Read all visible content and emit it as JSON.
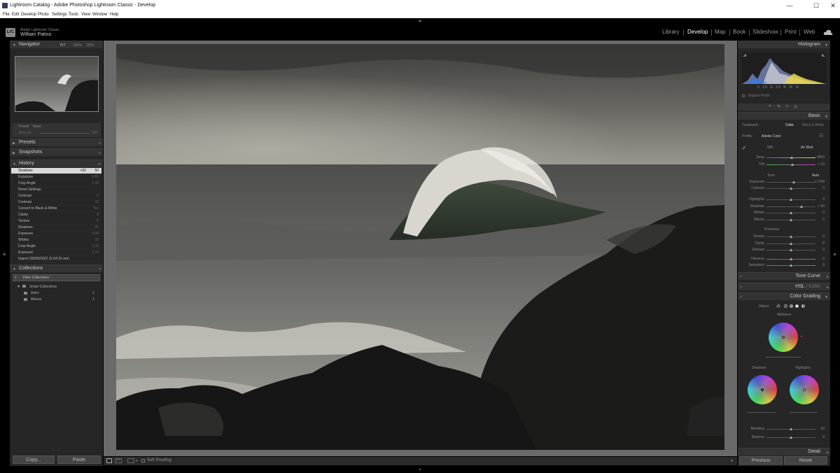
{
  "window": {
    "title": "Lightroom Catalog - Adobe Photoshop Lightroom Classic - Develop",
    "minimize": "—",
    "maximize": "☐",
    "close": "✕"
  },
  "menu": [
    "File",
    "Edit",
    "Develop",
    "Photo",
    "Settings",
    "Tools",
    "View",
    "Window",
    "Help"
  ],
  "identity": {
    "badge": "LrC",
    "app": "Adobe Lightroom Classic",
    "user": "William Patino"
  },
  "modules": [
    "Library",
    "Develop",
    "Map",
    "Book",
    "Slideshow",
    "Print",
    "Web"
  ],
  "active_module": "Develop",
  "navigator": {
    "title": "Navigator",
    "fit": "FIT",
    "z1": "100%",
    "z2": "25%"
  },
  "preset_amount": {
    "label1": "Preset",
    "label2": "None",
    "amount_label": "Amount",
    "amount_value": "100"
  },
  "left_panels": {
    "presets": "Presets",
    "snapshots": "Snapshots",
    "history": "History",
    "collections": "Collections"
  },
  "history": [
    {
      "name": "Shadows",
      "a": "+50",
      "b": "50",
      "selected": true
    },
    {
      "name": "Exposure",
      "a": "",
      "b": "0.89"
    },
    {
      "name": "Crop Angle",
      "a": "",
      "b": "1.30"
    },
    {
      "name": "Reset Settings",
      "a": "",
      "b": ""
    },
    {
      "name": "Contrast",
      "a": "",
      "b": "0"
    },
    {
      "name": "Contrast",
      "a": "",
      "b": "20"
    },
    {
      "name": "Convert to Black & White",
      "a": "",
      "b": "Yes"
    },
    {
      "name": "Clarity",
      "a": "",
      "b": "8"
    },
    {
      "name": "Texture",
      "a": "",
      "b": "5"
    },
    {
      "name": "Shadows",
      "a": "",
      "b": "31"
    },
    {
      "name": "Exposure",
      "a": "",
      "b": "0.94"
    },
    {
      "name": "Whites",
      "a": "",
      "b": "10"
    },
    {
      "name": "Crop Angle",
      "a": "",
      "b": "1.30"
    },
    {
      "name": "Exposure",
      "a": "",
      "b": "1.47"
    },
    {
      "name": "Import (30/06/2022 11:54:32 am)",
      "a": "",
      "b": ""
    }
  ],
  "collections": {
    "filter": "Filter Collections",
    "smart": "Smart Collections",
    "items": [
      {
        "name": "Astro",
        "count": "1"
      },
      {
        "name": "Waves",
        "count": "1"
      }
    ]
  },
  "left_buttons": {
    "copy": "Copy...",
    "paste": "Paste"
  },
  "toolbar": {
    "soft_proofing": "Soft Proofing"
  },
  "histogram": {
    "title": "Histogram",
    "readout": "0   1.8   G   2.0   B   16   %",
    "original": "Original Photo"
  },
  "basic": {
    "title": "Basic",
    "treatment": "Treatment :",
    "color": "Color",
    "bw": "Black & White",
    "profile_label": "Profile :",
    "profile_value": "Adobe Color",
    "wb_label": "WB :",
    "wb_value": "As Shot",
    "tone_label": "Tone",
    "auto": "Auto",
    "presence_label": "Presence",
    "sliders": [
      {
        "name": "Temp",
        "value": "4550",
        "pos": 0.52
      },
      {
        "name": "Tint",
        "value": "+ 10",
        "pos": 0.53
      },
      {
        "name": "Exposure",
        "value": "+ 0.89",
        "pos": 0.56
      },
      {
        "name": "Contrast",
        "value": "0",
        "pos": 0.5
      },
      {
        "name": "Highlights",
        "value": "0",
        "pos": 0.5
      },
      {
        "name": "Shadows",
        "value": "+ 50",
        "pos": 0.72
      },
      {
        "name": "Whites",
        "value": "0",
        "pos": 0.5
      },
      {
        "name": "Blacks",
        "value": "0",
        "pos": 0.5
      },
      {
        "name": "Texture",
        "value": "0",
        "pos": 0.5
      },
      {
        "name": "Clarity",
        "value": "0",
        "pos": 0.5
      },
      {
        "name": "Dehaze",
        "value": "0",
        "pos": 0.5
      },
      {
        "name": "Vibrance",
        "value": "0",
        "pos": 0.5
      },
      {
        "name": "Saturation",
        "value": "0",
        "pos": 0.5
      }
    ]
  },
  "tone_curve": {
    "title": "Tone Curve"
  },
  "hsl": {
    "title": "HSL",
    "sep": " / ",
    "color": "Color"
  },
  "color_grading": {
    "title": "Color Grading",
    "adjust": "Adjust :",
    "midtones": "Midtones",
    "shadows": "Shadows",
    "highlights": "Highlights",
    "blending_label": "Blending",
    "blending_value": "50",
    "blending_pos": 0.5,
    "balance_label": "Balance",
    "balance_value": "0",
    "balance_pos": 0.5
  },
  "detail": {
    "title": "Detail"
  },
  "right_buttons": {
    "previous": "Previous",
    "reset": "Reset"
  },
  "colors": {
    "bg": "#262626",
    "header": "#333333",
    "accent": "#ffffff",
    "canvas": "#6a6a6a"
  }
}
